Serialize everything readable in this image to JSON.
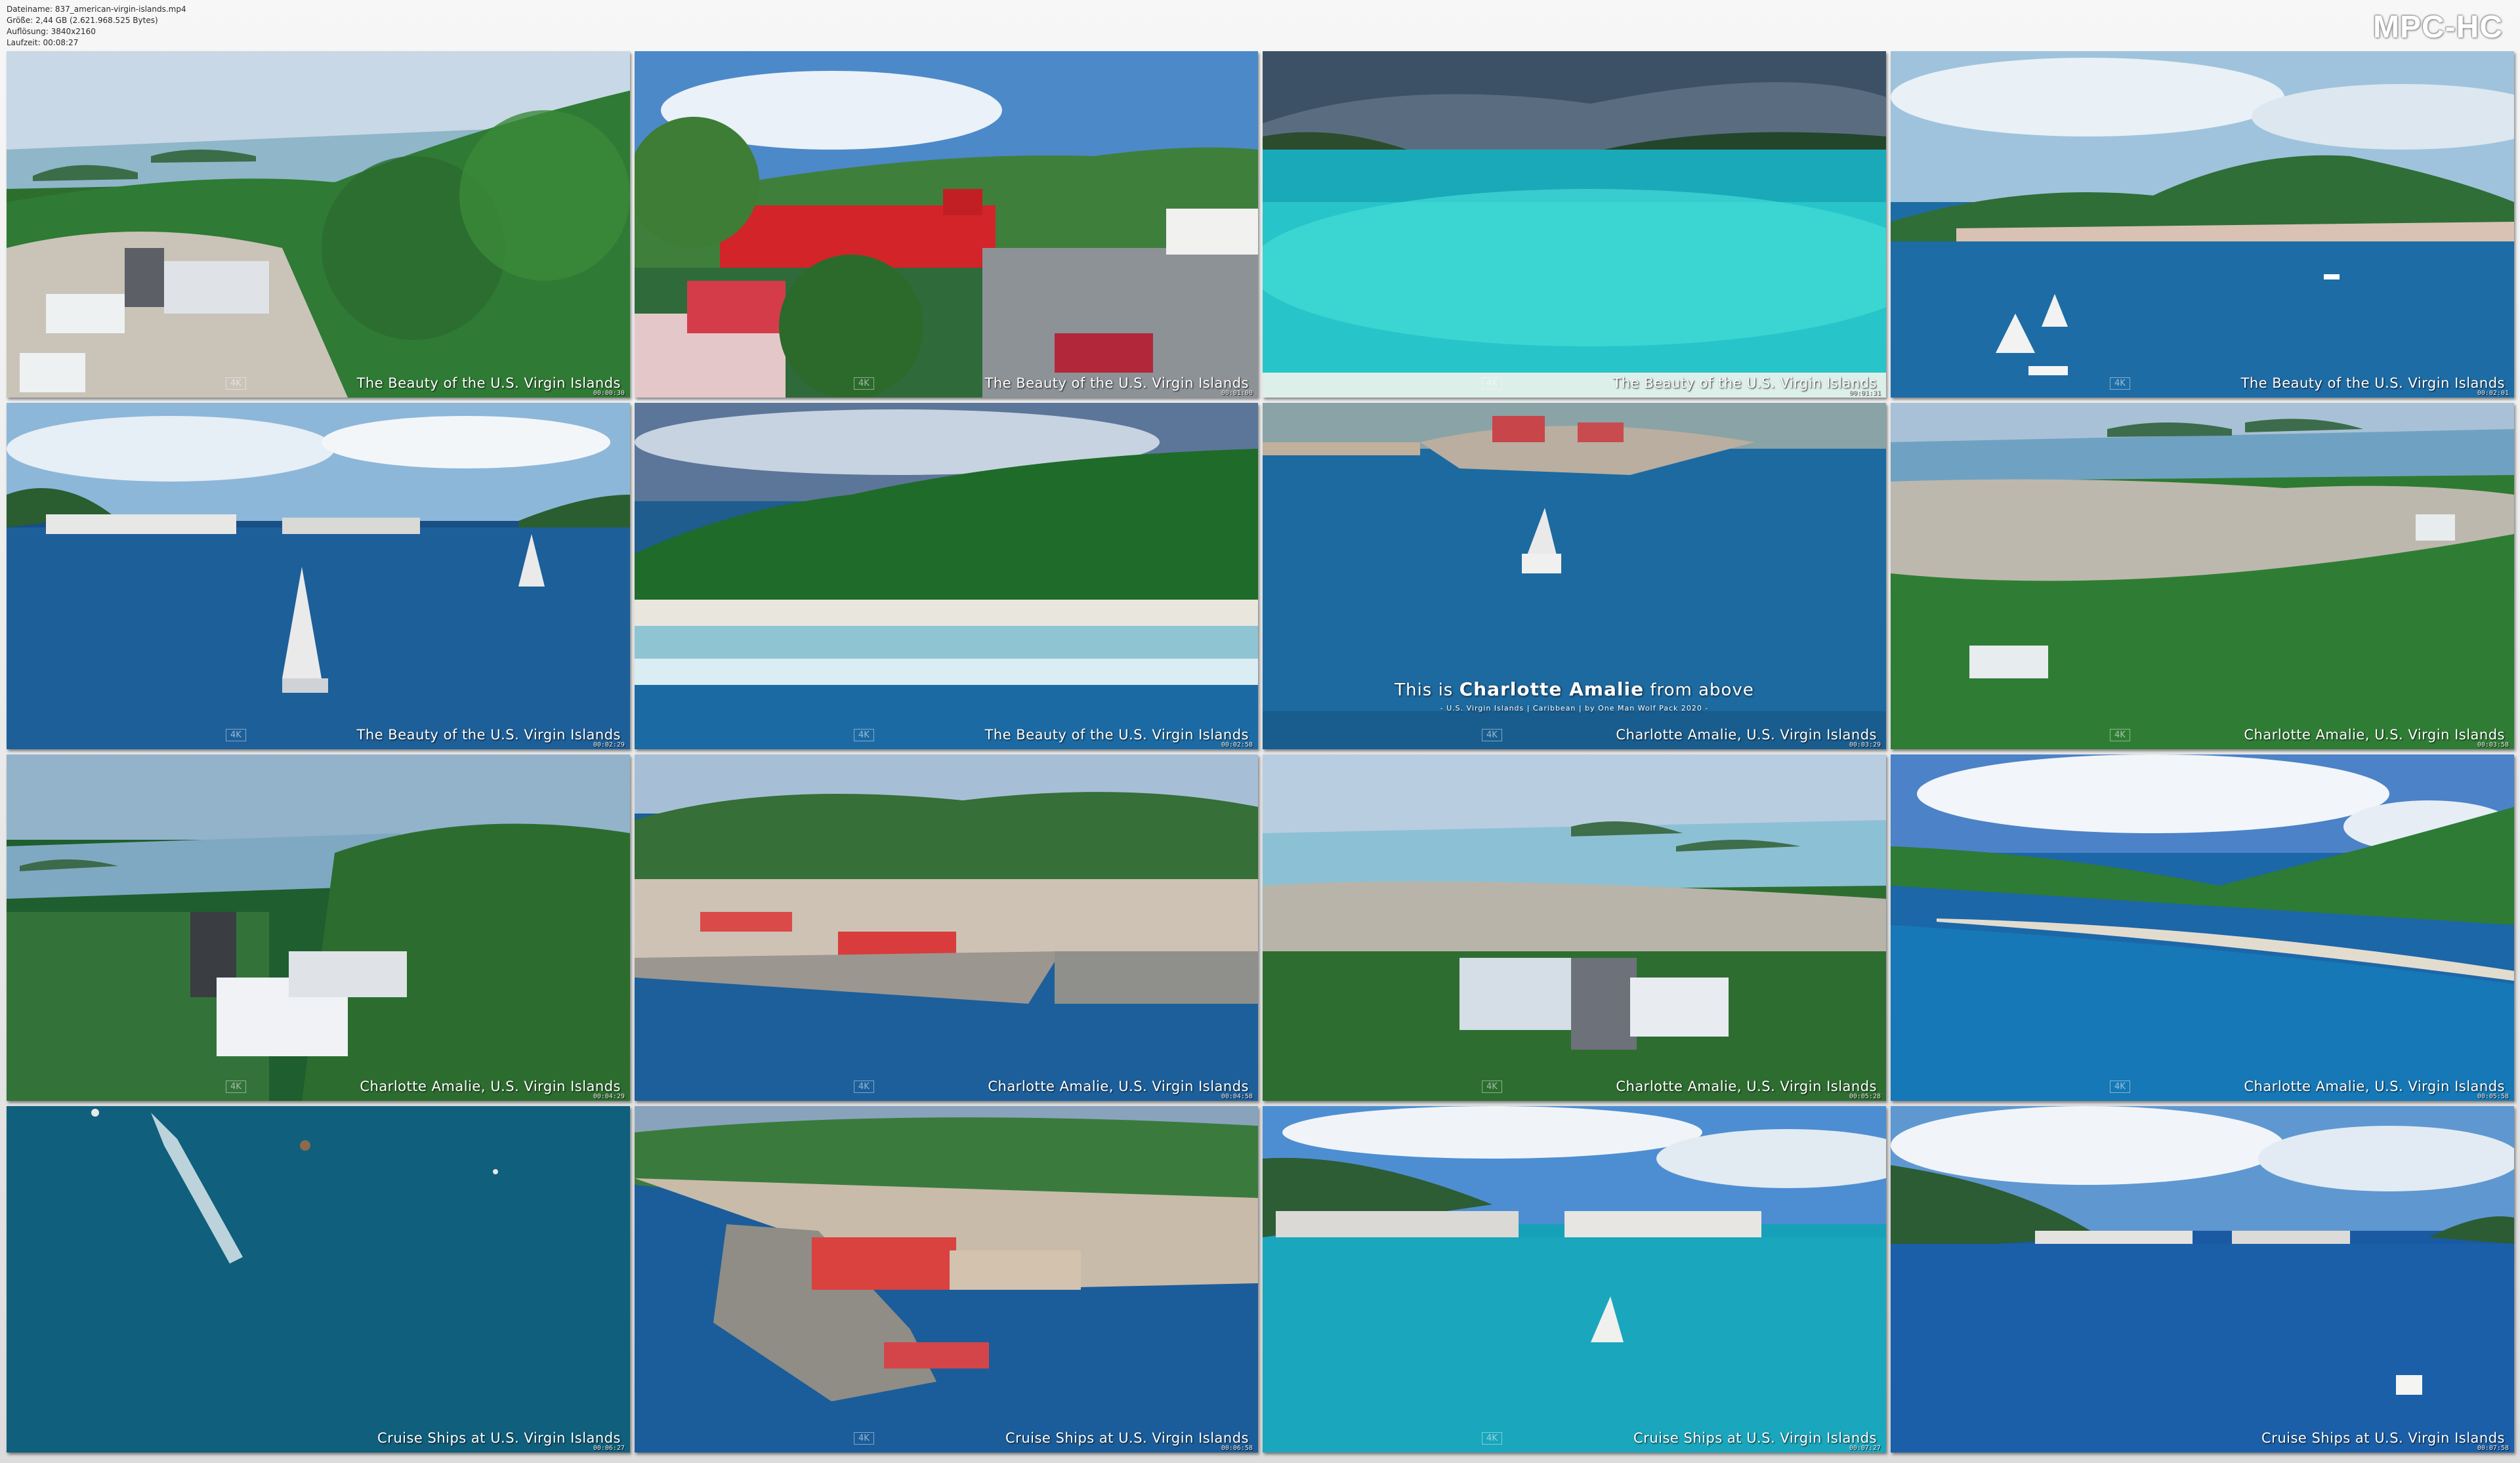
{
  "player": {
    "brand": "MPC-HC",
    "file_info": [
      "Dateiname: 837_american-virgin-islands.mp4",
      "Größe: 2,44 GB (2.621.968.525 Bytes)",
      "Auflösung: 3840x2160",
      "Laufzeit: 00:08:27"
    ]
  },
  "title_card": {
    "line1_prefix": "This is",
    "line1_highlight": "Charlotte Amalie",
    "line1_suffix": "from above",
    "line2": "- U.S. Virgin Islands | Caribbean | by One Man Wolf Pack 2020 -"
  },
  "watermark": "4K",
  "thumbnails": [
    {
      "caption": "The Beauty of the U.S. Virgin Islands",
      "time": "00:00:30",
      "scene": "hillside"
    },
    {
      "caption": "The Beauty of the U.S. Virgin Islands",
      "time": "00:01:00",
      "scene": "redfort"
    },
    {
      "caption": "The Beauty of the U.S. Virgin Islands",
      "time": "00:01:31",
      "scene": "lagoon"
    },
    {
      "caption": "The Beauty of the U.S. Virgin Islands",
      "time": "00:02:01",
      "scene": "harbor"
    },
    {
      "caption": "The Beauty of the U.S. Virgin Islands",
      "time": "00:02:29",
      "scene": "cruiseships_far"
    },
    {
      "caption": "The Beauty of the U.S. Virgin Islands",
      "time": "00:02:58",
      "scene": "beach"
    },
    {
      "caption": "Charlotte Amalie, U.S. Virgin Islands",
      "time": "00:03:29",
      "scene": "catamaran"
    },
    {
      "caption": "Charlotte Amalie, U.S. Virgin Islands",
      "time": "00:03:58",
      "scene": "townslope"
    },
    {
      "caption": "Charlotte Amalie, U.S. Virgin Islands",
      "time": "00:04:29",
      "scene": "tower"
    },
    {
      "caption": "Charlotte Amalie, U.S. Virgin Islands",
      "time": "00:04:58",
      "scene": "waterfront"
    },
    {
      "caption": "Charlotte Amalie, U.S. Virgin Islands",
      "time": "00:05:28",
      "scene": "villa"
    },
    {
      "caption": "Charlotte Amalie, U.S. Virgin Islands",
      "time": "00:05:58",
      "scene": "bay"
    },
    {
      "caption": "Cruise Ships at U.S. Virgin Islands",
      "time": "00:06:27",
      "scene": "openwater"
    },
    {
      "caption": "Cruise Ships at U.S. Virgin Islands",
      "time": "00:06:58",
      "scene": "peninsula"
    },
    {
      "caption": "Cruise Ships at U.S. Virgin Islands",
      "time": "00:07:27",
      "scene": "cruisedock"
    },
    {
      "caption": "Cruise Ships at U.S. Virgin Islands",
      "time": "00:07:58",
      "scene": "anchorage"
    }
  ]
}
